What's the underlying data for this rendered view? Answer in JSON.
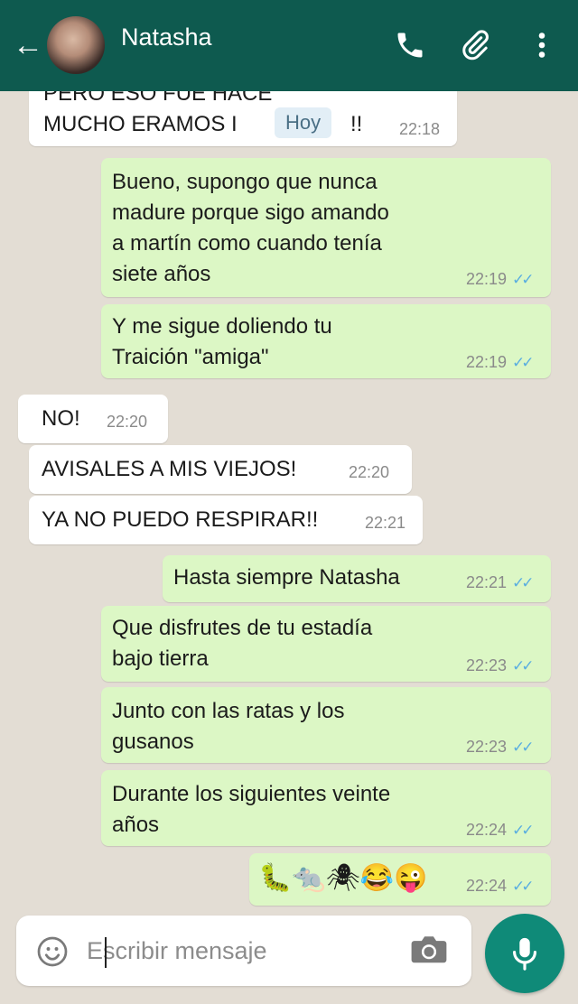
{
  "header": {
    "back_label": "←",
    "contact_name": "Natasha",
    "bg_color": "#0e5a4f",
    "icons": [
      "phone-icon",
      "paperclip-icon",
      "more-vert-icon"
    ]
  },
  "messages": [
    {
      "dir": "in",
      "lines": [
        "PERO ESO FUE HACE",
        "MUCHO ERAMOS I"
      ],
      "badge": "Hoy",
      "tail": "!!",
      "time": "22:18"
    },
    {
      "dir": "out",
      "lines": [
        "Bueno, supongo que nunca",
        "madure porque sigo amando",
        "a martín como cuando tenía",
        "siete años"
      ],
      "time": "22:19"
    },
    {
      "dir": "out",
      "lines": [
        "Y me sigue doliendo tu",
        "Traición \"amiga\""
      ],
      "time": "22:19"
    },
    {
      "dir": "in",
      "lines": [
        "NO!"
      ],
      "time": "22:20"
    },
    {
      "dir": "in",
      "lines": [
        "AVISALES A MIS VIEJOS!"
      ],
      "time": "22:20"
    },
    {
      "dir": "in",
      "lines": [
        "YA NO PUEDO RESPIRAR!!"
      ],
      "time": "22:21"
    },
    {
      "dir": "out",
      "lines": [
        "Hasta siempre Natasha"
      ],
      "time": "22:21"
    },
    {
      "dir": "out",
      "lines": [
        "Que disfrutes de tu estadía",
        "bajo tierra"
      ],
      "time": "22:23"
    },
    {
      "dir": "out",
      "lines": [
        "Junto con las ratas y los",
        "gusanos"
      ],
      "time": "22:23"
    },
    {
      "dir": "out",
      "lines": [
        "Durante los siguientes veinte",
        "años"
      ],
      "time": "22:24"
    },
    {
      "dir": "out",
      "lines": [
        "🐛🐀🕷😂😜"
      ],
      "time": "22:24"
    }
  ],
  "composer": {
    "placeholder": "Escribir mensaje"
  },
  "colors": {
    "chat_bg": "#e3ddd4",
    "bubble_in": "#ffffff",
    "bubble_out": "#dcf7c5",
    "read_ticks": "#5aaee0",
    "fab": "#0f8a78"
  }
}
